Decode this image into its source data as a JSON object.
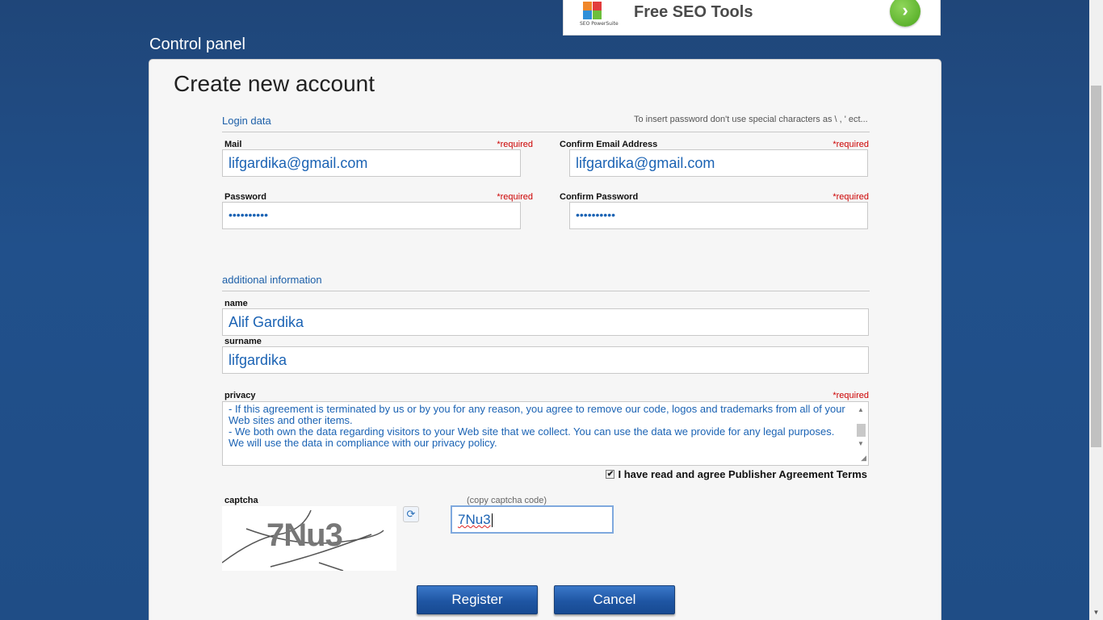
{
  "ad": {
    "text": "Free SEO Tools",
    "logo_caption": "SEO PowerSuite",
    "arrow": "›"
  },
  "panel_title": "Control panel",
  "card_title": "Create new account",
  "login": {
    "section_title": "Login data",
    "hint": "To insert password don't use special characters as \\ , ' ect...",
    "mail_label": "Mail",
    "mail_value": "lifgardika@gmail.com",
    "confirm_email_label": "Confirm Email Address",
    "confirm_email_value": "lifgardika@gmail.com",
    "password_label": "Password",
    "password_value": "••••••••••",
    "confirm_password_label": "Confirm Password",
    "confirm_password_value": "••••••••••",
    "required": "*required"
  },
  "additional": {
    "section_title": "additional information",
    "name_label": "name",
    "name_value": "Alif Gardika",
    "surname_label": "surname",
    "surname_value": "lifgardika",
    "privacy_label": "privacy",
    "privacy_text": [
      "   - If this agreement is terminated by us or by you for any reason, you agree to remove our code, logos and trademarks from all of your Web sites and other items.",
      "   - We both own the data regarding visitors to your Web site that we collect. You can use the data we provide for any legal purposes. We will use the data in compliance with our privacy policy."
    ],
    "agree_label": "I have read and agree Publisher Agreement Terms",
    "agree_checked": true
  },
  "captcha": {
    "label": "captcha",
    "image_text": "7Nu3",
    "copy_hint": "(copy captcha code)",
    "input_value": "7Nu3"
  },
  "buttons": {
    "register": "Register",
    "cancel": "Cancel"
  }
}
